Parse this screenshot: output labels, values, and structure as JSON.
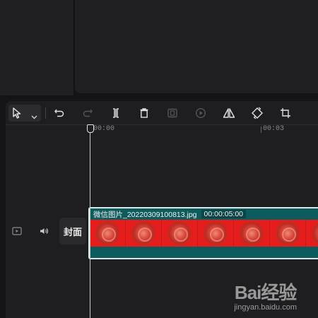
{
  "toolbar": {
    "tools": [
      "select-tool",
      "undo",
      "redo",
      "split",
      "delete",
      "freeze",
      "play-reverse",
      "mirror",
      "rotate",
      "crop"
    ]
  },
  "ruler": {
    "ticks": [
      "00:00",
      "00:03"
    ]
  },
  "track": {
    "cover_label": "封面"
  },
  "clip": {
    "name": "微信图片_20220309100813.jpg",
    "duration": "00:00:05:00",
    "color": "#0e5b5e"
  },
  "watermark": {
    "logo": "Bai经验",
    "url": "jingyan.baidu.com"
  }
}
